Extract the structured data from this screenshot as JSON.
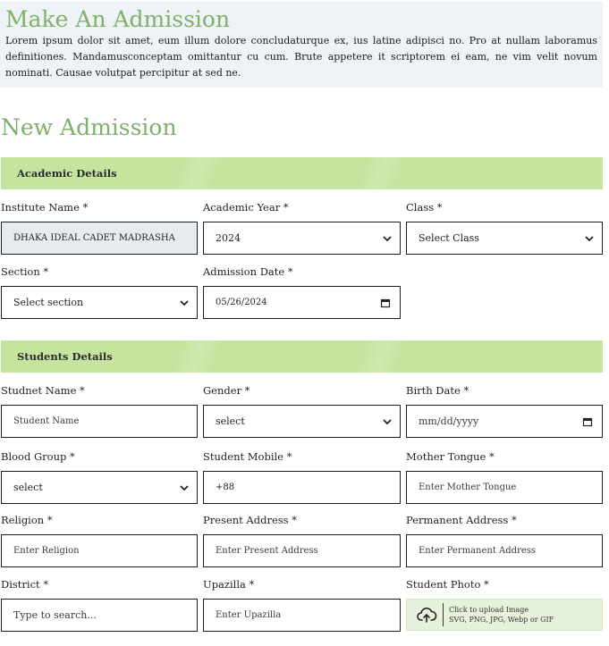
{
  "intro": {
    "title": "Make An Admission",
    "text": "Lorem ipsum dolor sit amet, eum illum dolore concludaturque ex, ius latine adipisci no. Pro at nullam laboramus definitiones. Mandamusconceptam omittantur cu cum. Brute appetere it scriptorem ei eam, ne vim velit novum nominati. Causae volutpat percipitur at sed ne."
  },
  "page_title": "New Admission",
  "academic": {
    "heading": "Academic Details",
    "institute_label": "Institute Name *",
    "institute_value": "DHAKA IDEAL CADET MADRASHA",
    "year_label": "Academic Year *",
    "year_value": "2024",
    "class_label": "Class *",
    "class_value": "Select Class",
    "section_label": "Section *",
    "section_value": "Select section",
    "date_label": "Admission Date *",
    "date_value": "05/26/2024"
  },
  "student": {
    "heading": "Students Details",
    "name_label": "Studnet Name *",
    "name_placeholder": "Student Name",
    "gender_label": "Gender *",
    "gender_value": "select",
    "birth_label": "Birth Date *",
    "birth_placeholder": "mm/dd/yyyy",
    "blood_label": "Blood Group *",
    "blood_value": "select",
    "mobile_label": "Student Mobile *",
    "mobile_value": "+88",
    "tongue_label": "Mother Tongue *",
    "tongue_placeholder": "Enter Mother Tongue",
    "religion_label": "Religion *",
    "religion_placeholder": "Enter Religion",
    "present_label": "Present Address *",
    "present_placeholder": "Enter Present Address",
    "permanent_label": "Permanent Address *",
    "permanent_placeholder": "Enter Permanent Address",
    "district_label": "District *",
    "district_placeholder": "Type to search...",
    "upazilla_label": "Upazilla *",
    "upazilla_placeholder": "Enter Upazilla",
    "photo_label": "Student Photo *",
    "photo_line1": "Click to upload Image",
    "photo_line2": "SVG, PNG, JPG, Webp or GIF"
  },
  "icons": {
    "select_arrow": "chevron-down-icon",
    "calendar": "calendar-icon",
    "upload": "cloud-upload-icon"
  },
  "colors": {
    "accent_green": "#7fb069",
    "band_green": "#c5e59f",
    "intro_bg": "#eff3f8"
  }
}
